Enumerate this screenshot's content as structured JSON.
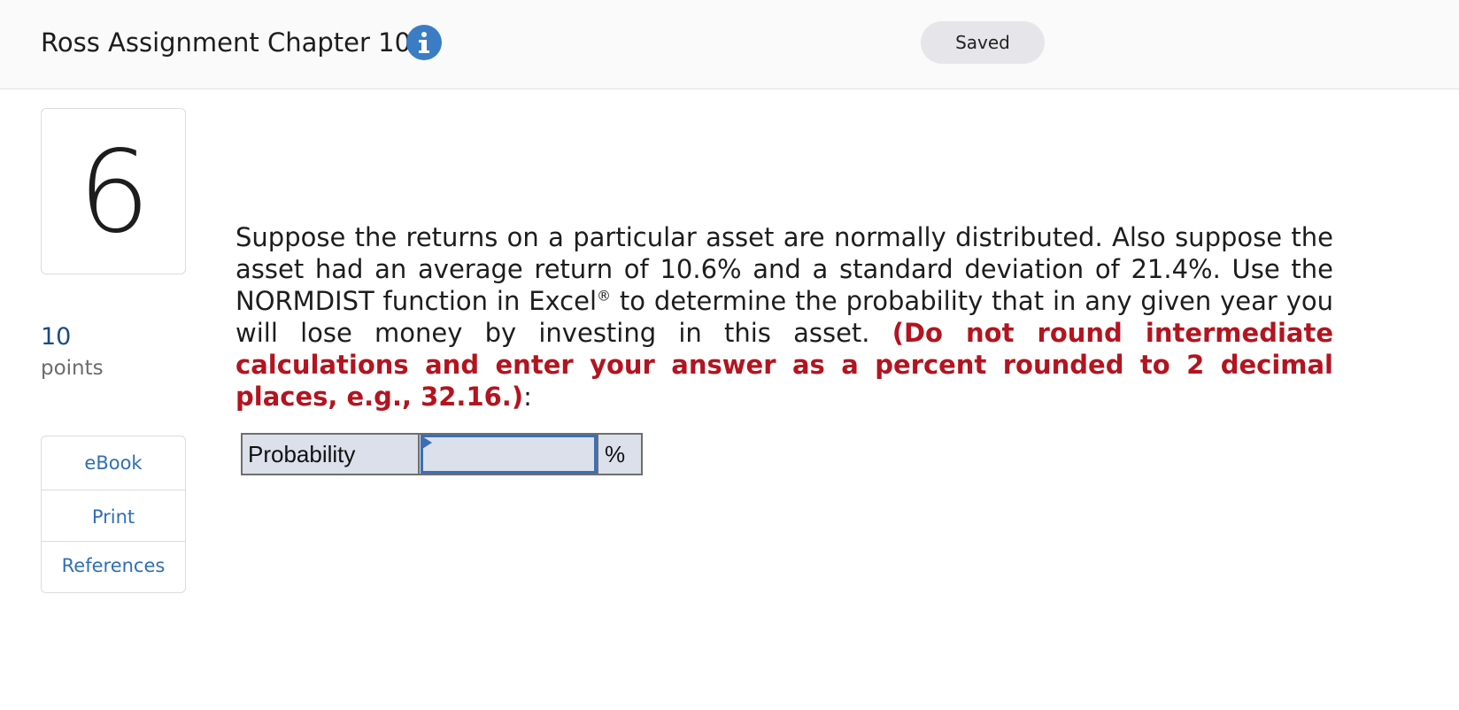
{
  "header": {
    "title": "Ross Assignment Chapter 10",
    "info_icon": "info-icon",
    "status": "Saved"
  },
  "question": {
    "number": "6",
    "points_value": "10",
    "points_label": "points",
    "text_main": "Suppose the returns on a particular asset are normally distributed. Also suppose the asset had an average return of 10.6% and a standard deviation of 21.4%. Use the NORMDIST function in Excel",
    "registered_mark": "®",
    "text_after_mark": " to determine the probability that in any given year you will lose money by investing in this asset. ",
    "instruction": "(Do not round intermediate calculations and enter your answer as a percent rounded to 2 decimal places, e.g., 32.16.)",
    "trailing": ":"
  },
  "resources": {
    "items": [
      {
        "label": "eBook"
      },
      {
        "label": "Print"
      },
      {
        "label": "References"
      }
    ]
  },
  "answer": {
    "label": "Probability",
    "value": "",
    "unit": "%"
  },
  "colors": {
    "accent_blue": "#3b7dc4",
    "link_blue": "#2f6fb5",
    "instruction_red": "#b3141f",
    "input_fill": "#dbe0ea"
  }
}
